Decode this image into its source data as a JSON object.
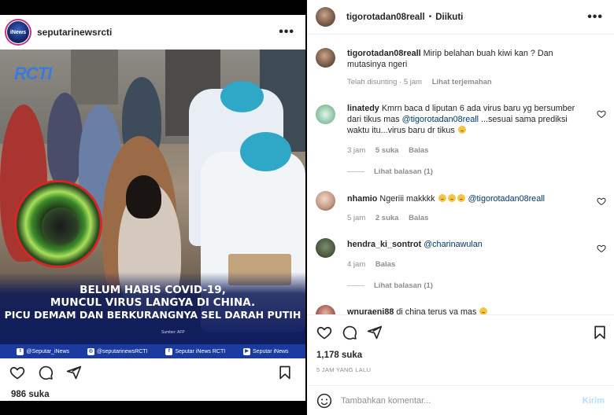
{
  "post": {
    "username": "seputarinewsrcti",
    "image": {
      "logo": "RCTI",
      "caption_lines": [
        "BELUM HABIS COVID-19,",
        "MUNCUL VIRUS LANGYA DI CHINA.",
        "PICU DEMAM DAN BERKURANGNYA SEL DARAH PUTIH"
      ],
      "source": "Sumber: AFP",
      "social": [
        {
          "icon": "twitter-icon",
          "label": "@Seputar_iNews"
        },
        {
          "icon": "instagram-icon",
          "label": "@seputarinewsRCTI"
        },
        {
          "icon": "facebook-icon",
          "label": "Seputar iNews RCTI"
        },
        {
          "icon": "youtube-icon",
          "label": "Seputar iNews"
        }
      ]
    },
    "likes": "986 suka"
  },
  "detail": {
    "username": "tigorotadan08reall",
    "separator": "•",
    "follow_label": "Diikuti",
    "comments": [
      {
        "user": "tigorotadan08reall",
        "text": "Mirip belahan buah kiwi kan ? Dan mutasinya ngeri",
        "time": "Telah disunting · 5 jam",
        "extra": "Lihat terjemahan"
      },
      {
        "user": "linatedy",
        "text_before": "Kmrn baca d liputan 6 ada virus baru yg bersumber dari tikus mas ",
        "mention": "@tigorotadan08reall",
        "text_after": " ...sesuai sama prediksi waktu itu...virus baru dr tikus",
        "time": "3 jam",
        "likes": "5 suka",
        "reply": "Balas",
        "view_replies": "Lihat balasan (1)"
      },
      {
        "user": "nhamio",
        "text_before": "Ngeriii makkkk",
        "mention": "@tigorotadan08reall",
        "time": "5 jam",
        "likes": "2 suka",
        "reply": "Balas"
      },
      {
        "user": "hendra_ki_sontrot",
        "mention": "@charinawulan",
        "time": "4 jam",
        "reply": "Balas",
        "view_replies": "Lihat balasan (1)"
      },
      {
        "user": "wnuraeni88",
        "text": "di china terus ya mas"
      }
    ],
    "likes": "1,178 suka",
    "time_ago": "5 JAM YANG LALU",
    "comment_placeholder": "Tambahkan komentar...",
    "post_label": "Kirim"
  },
  "colors": {
    "story_ring": "#c13584",
    "mention": "#00376b",
    "muted": "#8e8e8e",
    "post_button": "#b2dffc",
    "caption_band": "#0f1d60",
    "social_bar": "#1c3ba0"
  }
}
